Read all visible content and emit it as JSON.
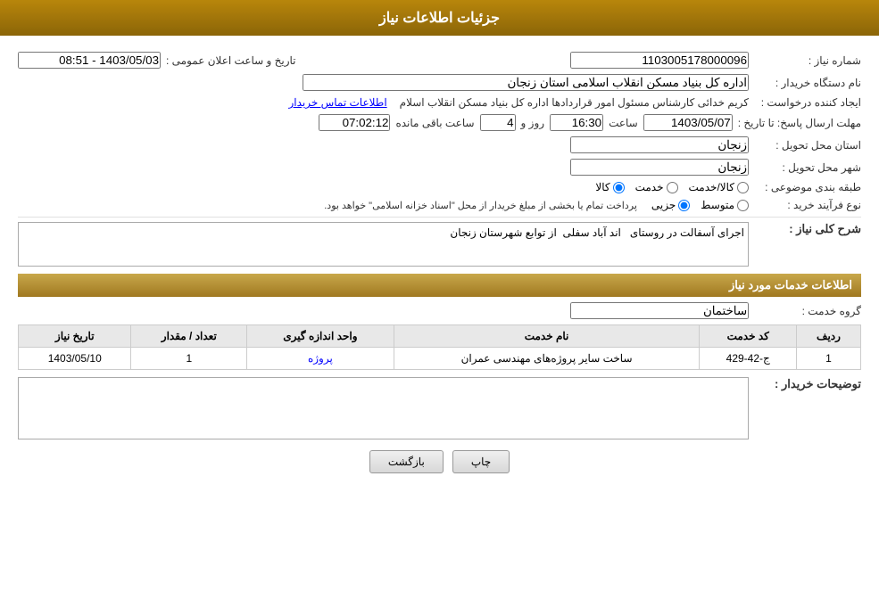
{
  "header": {
    "title": "جزئیات اطلاعات نیاز"
  },
  "fields": {
    "need_number_label": "شماره نیاز :",
    "need_number_value": "1103005178000096",
    "announcement_date_label": "تاریخ و ساعت اعلان عمومی :",
    "announcement_date_value": "1403/05/03 - 08:51",
    "buyer_org_label": "نام دستگاه خریدار :",
    "buyer_org_value": "اداره کل بنیاد مسکن انقلاب اسلامی استان زنجان",
    "requestor_label": "ایجاد کننده درخواست :",
    "requestor_value": "کریم خدائی کارشناس مسئول امور قراردادها اداره کل بنیاد مسکن انقلاب اسلام",
    "requestor_link": "اطلاعات تماس خریدار",
    "reply_deadline_label": "مهلت ارسال پاسخ: تا تاریخ :",
    "reply_date_value": "1403/05/07",
    "reply_time_value": "16:30",
    "reply_days_value": "4",
    "reply_remaining_value": "07:02:12",
    "reply_time_label": "ساعت",
    "reply_days_label": "روز و",
    "reply_remaining_label": "ساعت باقی مانده",
    "delivery_province_label": "استان محل تحویل :",
    "delivery_province_value": "زنجان",
    "delivery_city_label": "شهر محل تحویل :",
    "delivery_city_value": "زنجان",
    "category_label": "طبقه بندی موضوعی :",
    "category_options": [
      "کالا",
      "خدمت",
      "کالا/خدمت"
    ],
    "category_selected": "کالا",
    "process_label": "نوع فرآیند خرید :",
    "process_options": [
      "جزیی",
      "متوسط"
    ],
    "process_desc": "پرداخت تمام یا بخشی از مبلغ خریدار از محل \"اسناد خزانه اسلامی\" خواهد بود.",
    "description_label": "شرح کلی نیاز :",
    "description_value": "اجرای آسفالت در روستای   اند آباد سفلی  از توابع شهرستان زنجان",
    "services_section_label": "اطلاعات خدمات مورد نیاز",
    "service_group_label": "گروه خدمت :",
    "service_group_value": "ساختمان",
    "table": {
      "columns": [
        "ردیف",
        "کد خدمت",
        "نام خدمت",
        "واحد اندازه گیری",
        "تعداد / مقدار",
        "تاریخ نیاز"
      ],
      "rows": [
        {
          "index": "1",
          "code": "ج-42-429",
          "name": "ساخت سایر پروژه‌های مهندسی عمران",
          "unit": "پروژه",
          "quantity": "1",
          "date": "1403/05/10"
        }
      ]
    },
    "buyer_notes_label": "توضیحات خریدار :",
    "buyer_notes_value": ""
  },
  "buttons": {
    "print_label": "چاپ",
    "back_label": "بازگشت"
  }
}
